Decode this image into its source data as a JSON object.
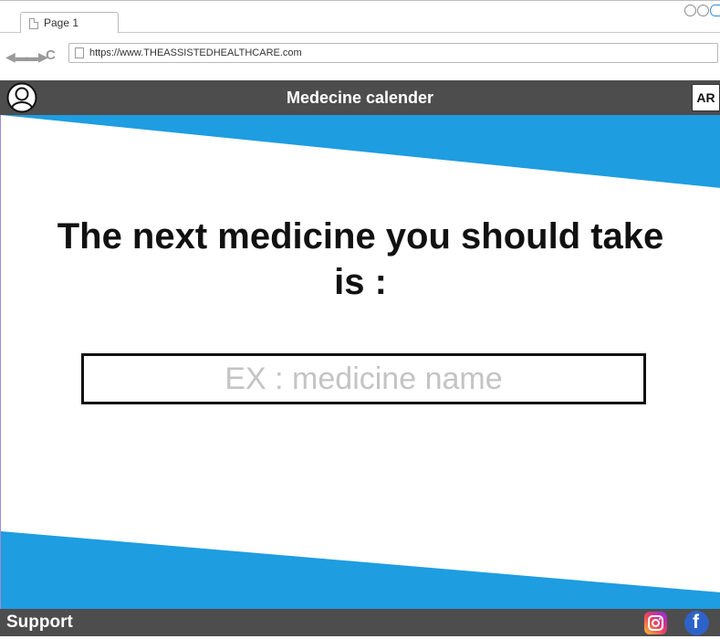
{
  "browser": {
    "tab_label": "Page 1",
    "url": "https://www.THEASSISTEDHEALTHCARE.com"
  },
  "header": {
    "title": "Medecine calender",
    "lang_button": "AR"
  },
  "main": {
    "headline": "The next medicine you should take is :",
    "medicine_field": {
      "value": "",
      "placeholder": "EX : medicine name"
    }
  },
  "footer": {
    "support_label": "Support"
  },
  "colors": {
    "accent": "#1e9de0",
    "bar": "#4d4d4d"
  },
  "icons": [
    "user-icon",
    "instagram-icon",
    "facebook-icon",
    "back-arrow-icon",
    "forward-arrow-icon",
    "reload-icon",
    "page-icon"
  ]
}
